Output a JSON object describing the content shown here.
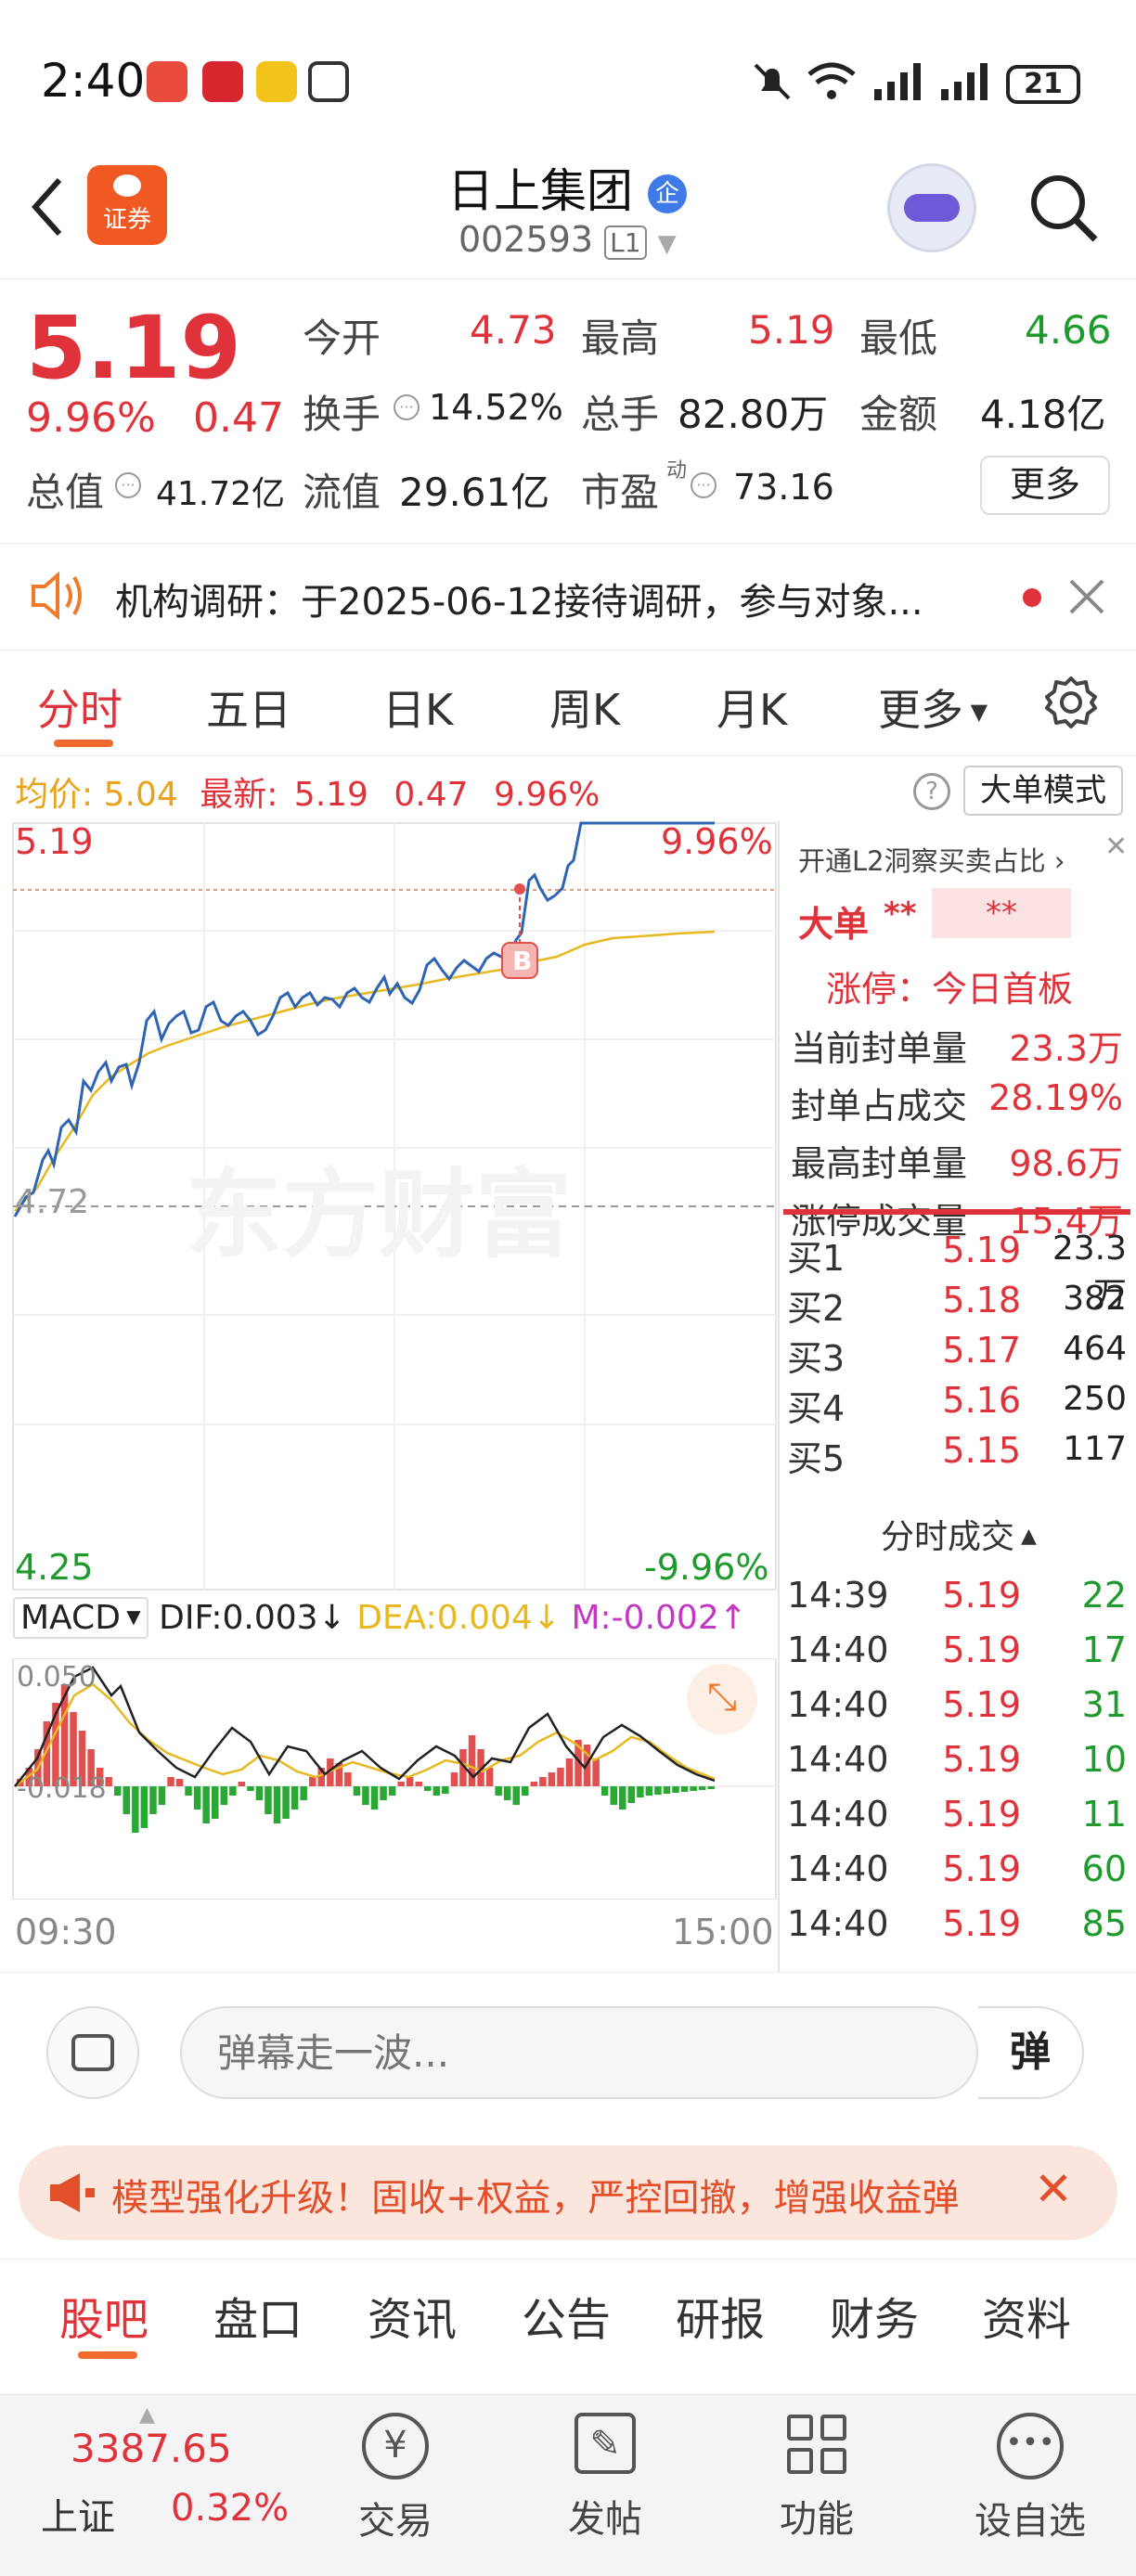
{
  "status_bar": {
    "time": "2:40",
    "battery": "21"
  },
  "nav": {
    "back_icon": "chevron-left-icon",
    "logo_label": "证券",
    "stock_name": "日上集团",
    "badge": "企",
    "stock_code": "002593",
    "level": "L1"
  },
  "quote": {
    "price": "5.19",
    "change_pct": "9.96%",
    "change": "0.47",
    "open_label": "今开",
    "open": "4.73",
    "high_label": "最高",
    "high": "5.19",
    "low_label": "最低",
    "low": "4.66",
    "turnover_label": "换手",
    "turnover": "14.52%",
    "volume_label": "总手",
    "volume": "82.80万",
    "amount_label": "金额",
    "amount": "4.18亿",
    "mktcap_label": "总值",
    "mktcap": "41.72亿",
    "float_label": "流值",
    "float": "29.61亿",
    "pe_label": "市盈",
    "pe_sup": "动",
    "pe": "73.16",
    "more_button": "更多"
  },
  "notice": {
    "text": "机构调研：于2025-06-12接待调研，参与对象..."
  },
  "tabs": {
    "items": [
      "分时",
      "五日",
      "日K",
      "周K",
      "月K",
      "更多"
    ],
    "active": 0
  },
  "chart_header": {
    "avg_label": "均价:",
    "avg": "5.04",
    "latest_label": "最新:",
    "latest": "5.19",
    "chg": "0.47",
    "pct": "9.96%",
    "mode_button": "大单模式"
  },
  "chart_labels": {
    "top_price": "5.19",
    "top_pct": "9.96%",
    "mid_price": "4.72",
    "bottom_price": "4.25",
    "bottom_pct": "-9.96%",
    "marker": "B",
    "watermark": "东方财富",
    "start_time": "09:30",
    "end_time": "15:00"
  },
  "macd": {
    "selector": "MACD",
    "dif": "DIF:0.003",
    "dea": "DEA:0.004",
    "m": "M:-0.002",
    "top": "0.050",
    "bottom": "-0.018"
  },
  "side_panel": {
    "l2_link": "开通L2洞察买卖占比",
    "big_label": "大单",
    "big_val1": "**",
    "big_val2": "**",
    "limit_title": "涨停：今日首板",
    "rows": [
      {
        "label": "当前封单量",
        "value": "23.3万"
      },
      {
        "label": "封单占成交",
        "value": "28.19%"
      },
      {
        "label": "最高封单量",
        "value": "98.6万"
      },
      {
        "label": "涨停成交量",
        "value": "15.4万"
      }
    ],
    "bids": [
      {
        "label": "买1",
        "price": "5.19",
        "vol": "23.3万"
      },
      {
        "label": "买2",
        "price": "5.18",
        "vol": "382"
      },
      {
        "label": "买3",
        "price": "5.17",
        "vol": "464"
      },
      {
        "label": "买4",
        "price": "5.16",
        "vol": "250"
      },
      {
        "label": "买5",
        "price": "5.15",
        "vol": "117"
      }
    ],
    "trades_title": "分时成交",
    "trades": [
      {
        "time": "14:39",
        "price": "5.19",
        "vol": "22"
      },
      {
        "time": "14:40",
        "price": "5.19",
        "vol": "17"
      },
      {
        "time": "14:40",
        "price": "5.19",
        "vol": "31"
      },
      {
        "time": "14:40",
        "price": "5.19",
        "vol": "10"
      },
      {
        "time": "14:40",
        "price": "5.19",
        "vol": "11"
      },
      {
        "time": "14:40",
        "price": "5.19",
        "vol": "60"
      },
      {
        "time": "14:40",
        "price": "5.19",
        "vol": "85"
      }
    ]
  },
  "comment": {
    "placeholder": "弹幕走一波...",
    "danmu_button": "弹"
  },
  "ad": {
    "text": "模型强化升级！固收+权益，严控回撤，增强收益弹"
  },
  "section_tabs": {
    "items": [
      "股吧",
      "盘口",
      "资讯",
      "公告",
      "研报",
      "财务",
      "资料"
    ],
    "active": 0
  },
  "bottom": {
    "index_value": "3387.65",
    "index_name": "上证",
    "index_pct": "0.32%",
    "items": [
      "交易",
      "发帖",
      "功能",
      "设自选"
    ]
  }
}
